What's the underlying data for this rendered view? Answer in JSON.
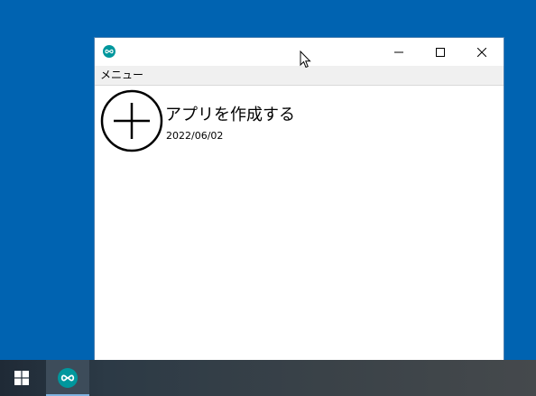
{
  "window": {
    "title": "",
    "app_icon": "arduino-infinity-icon",
    "controls": {
      "minimize_icon": "minimize-icon",
      "maximize_icon": "maximize-icon",
      "close_icon": "close-icon"
    }
  },
  "menubar": {
    "items": [
      {
        "label": "メニュー"
      }
    ]
  },
  "content": {
    "entries": [
      {
        "icon": "plus-circle-icon",
        "title": "アプリを作成する",
        "date": "2022/06/02"
      }
    ]
  },
  "taskbar": {
    "start_icon": "windows-logo-icon",
    "apps": [
      {
        "icon": "arduino-infinity-icon",
        "active": true
      }
    ]
  },
  "colors": {
    "desktop": "#0063b1",
    "window_bg": "#ffffff",
    "menubar_bg": "#f0f0f0",
    "app_icon_teal": "#00979d"
  }
}
